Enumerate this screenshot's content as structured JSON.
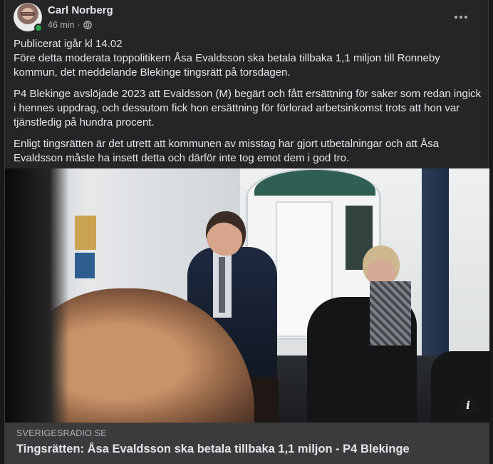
{
  "post": {
    "author": "Carl Norberg",
    "time": "46 min",
    "separator": "·",
    "privacy_icon": "globe-icon",
    "more_icon": "more-options-icon",
    "paragraphs": [
      "Publicerat igår kl 14.02\nFöre detta moderata toppolitikern Åsa Evaldsson ska betala tillbaka 1,1 miljon till Ronneby kommun, det meddelande Blekinge tingsrätt på torsdagen.",
      "P4 Blekinge avslöjade 2023 att Evaldsson (M) begärt och fått ersättning för saker som redan ingick i hennes uppdrag, och dessutom fick hon ersättning för förlorad arbetsinkomst trots att hon var tjänstledig på hundra procent.",
      "Enligt tingsrätten är det utrett att kommunen av misstag har gjort utbetalningar och att Åsa Evaldsson måste ha insett detta och därför inte tog emot dem i god tro."
    ]
  },
  "link_preview": {
    "domain": "SVERIGESRADIO.SE",
    "title": "Tingsrätten: Åsa Evaldsson ska betala tillbaka 1,1 miljon - P4 Blekinge",
    "info_glyph": "i"
  },
  "colors": {
    "background": "#18191a",
    "card": "#242526",
    "online": "#31a24c"
  }
}
